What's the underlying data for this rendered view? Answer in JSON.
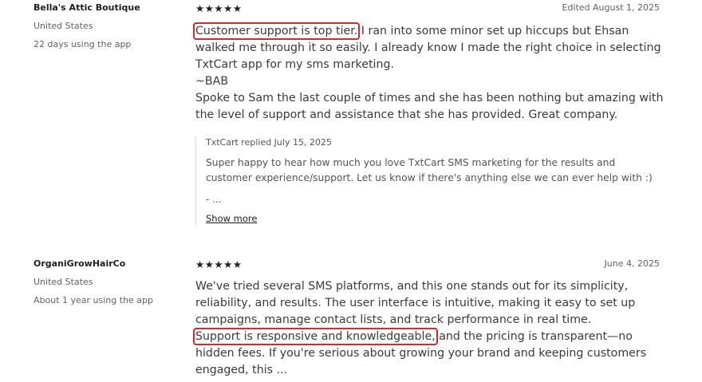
{
  "reviews": [
    {
      "merchant": "Bella's Attic Boutique",
      "location": "United States",
      "usage": "22 days using the app",
      "stars": "★★★★★",
      "date": "Edited August 1, 2025",
      "highlight": "Customer support is top tier.",
      "line1_rest": " I ran into some minor set up hiccups but Ehsan walked me through it so easily. I already know I made the right choice in selecting TxtCart app for my sms marketing.",
      "line_sign": "~BAB",
      "line_last": "Spoke to Sam the last couple of times and she has been nothing but amazing with the level of support and assistance that she has provided. Great company.",
      "reply": {
        "header": "TxtCart replied July 15, 2025",
        "text": "Super happy to hear how much you love TxtCart SMS marketing for the results and customer experience/support. Let us know if there's anything else we can ever help with :)",
        "dash": "- ...",
        "show_more": "Show more"
      }
    },
    {
      "merchant": "OrganiGrowHairCo",
      "location": "United States",
      "usage": "About 1 year using the app",
      "stars": "★★★★★",
      "date": "June 4, 2025",
      "pre": "We've tried several SMS platforms, and this one stands out for its simplicity, reliability, and results. The user interface is intuitive, making it easy to set up campaigns, manage contact lists, and track performance in real time.",
      "highlight": "Support is responsive and knowledgeable,",
      "post": " and the pricing is transparent—no hidden fees. If you're serious about growing your brand and keeping customers engaged, this ..."
    }
  ]
}
